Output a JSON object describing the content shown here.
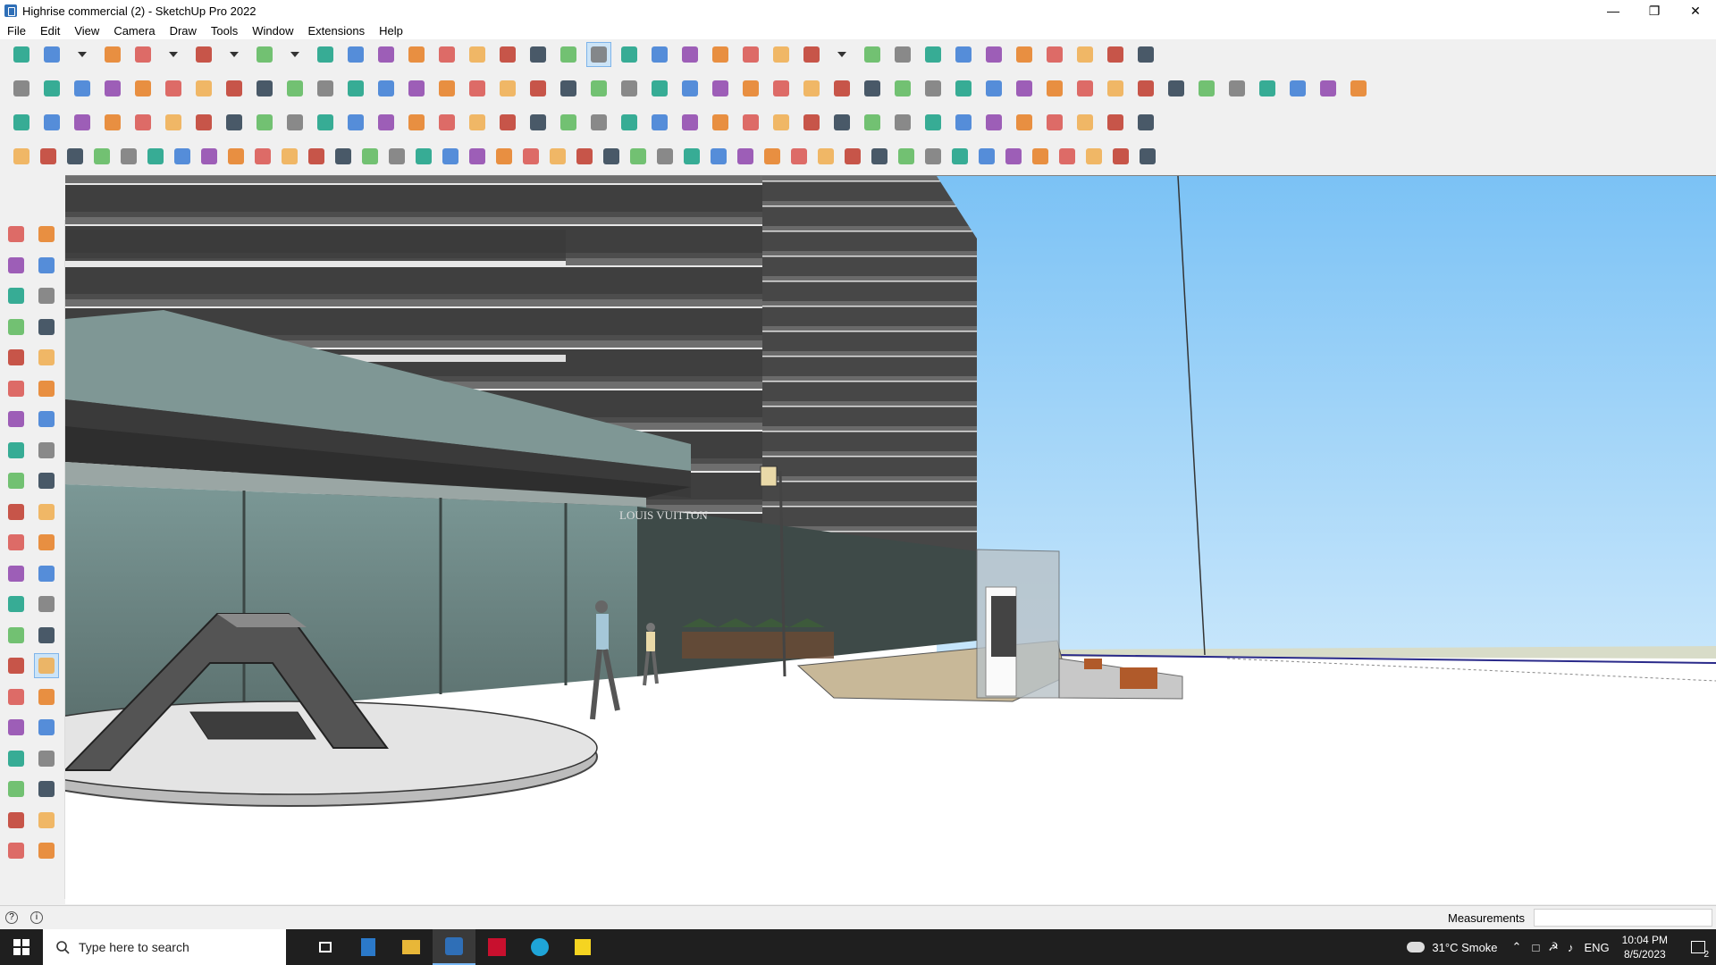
{
  "window": {
    "title": "Highrise commercial (2) - SketchUp Pro 2022",
    "controls": [
      "minimize",
      "restore",
      "close"
    ]
  },
  "menu": [
    "File",
    "Edit",
    "View",
    "Camera",
    "Draw",
    "Tools",
    "Window",
    "Extensions",
    "Help"
  ],
  "toolbar_rows": [
    {
      "icon_names": [
        "search-icon",
        "select-icon",
        "dropdown-icon",
        "eraser-icon",
        "pencil-icon",
        "dropdown-icon",
        "arc-icon",
        "dropdown-icon",
        "rectangle-icon",
        "dropdown-icon",
        "pushpull-icon",
        "followme-icon",
        "move-icon",
        "rotate-icon",
        "scale-icon",
        "tape-icon",
        "text-icon",
        "paint-icon",
        "orbit-icon",
        "pan-icon",
        "zoom-icon",
        "zoom-extents-icon",
        "section-icon",
        "section-display-icon",
        "section-fill-icon",
        "section-cut-icon",
        "component-icon",
        "dropdown-icon",
        "style-icon",
        "model-icon",
        "axis-icon",
        "arrow-up-down-icon",
        "arrow-down-up-icon",
        "scale-tool-icon",
        "xray-icon",
        "undo-icon",
        "redo-icon",
        "extension-icon"
      ]
    },
    {
      "icon_names": [
        "box-icon",
        "box-icon",
        "box-icon",
        "solid-icon",
        "solid-icon",
        "solid-icon",
        "solid-icon",
        "solid-icon",
        "solid-icon",
        "solid-icon",
        "solid-icon",
        "loop-icon",
        "line-icon",
        "line-icon",
        "line-icon",
        "shape-icon",
        "shape-icon",
        "house-icon",
        "house-icon",
        "house-icon",
        "house-icon",
        "house-icon",
        "house-icon",
        "curve-icon",
        "leaf-icon",
        "ruler-icon",
        "shape-icon",
        "shape-icon",
        "shape-icon",
        "shape-icon",
        "shape-icon",
        "shape-icon",
        "shape-icon",
        "shape-icon",
        "shape-icon",
        "shape-icon",
        "shape-icon",
        "shape-icon",
        "terrain-icon",
        "terrain-icon",
        "terrain-icon",
        "terrain-icon",
        "terrain-icon",
        "terrain-icon",
        "terrain-icon"
      ]
    },
    {
      "icon_names": [
        "plane-icon",
        "plane-icon",
        "plane-icon",
        "plane-icon",
        "plane-icon",
        "plane-icon",
        "loop-icon",
        "square-icon",
        "grid-icon",
        "shape-icon",
        "shape-icon",
        "shape-icon",
        "shape-icon",
        "shape-icon",
        "plus-icon",
        "plus-icon",
        "cross-icon",
        "cone-icon",
        "triangle-icon",
        "ring-icon",
        "ring-icon",
        "ring-icon",
        "star-icon",
        "cube-icon",
        "magnet-icon",
        "tool-icon",
        "tool-icon",
        "tool-icon",
        "tool-icon",
        "tool-icon",
        "tool-icon",
        "grid-icon",
        "grid-icon",
        "grid-icon",
        "grid-icon",
        "cross-icon",
        "curve-icon",
        "grid-icon"
      ]
    },
    {
      "icon_names": [
        "shape-icon",
        "shape-icon",
        "shape-icon",
        "shape-icon",
        "shape-icon",
        "shape-icon",
        "shape-icon",
        "shape-icon",
        "shape-icon",
        "shape-icon",
        "shape-icon",
        "shape-icon",
        "shape-icon",
        "shape-icon",
        "shape-icon",
        "shape-icon",
        "shape-icon",
        "shape-icon",
        "shape-icon",
        "shape-icon",
        "shape-icon",
        "shape-icon",
        "shape-icon",
        "shape-icon",
        "shape-icon",
        "shape-icon",
        "shape-icon",
        "shape-icon",
        "shape-icon",
        "shape-icon",
        "shape-icon",
        "shape-icon",
        "shape-icon",
        "shape-icon",
        "shape-icon",
        "shape-icon",
        "shape-icon",
        "shape-icon",
        "shape-icon",
        "shape-icon",
        "shape-icon",
        "shape-icon",
        "shape-icon"
      ]
    }
  ],
  "left_toolbar": {
    "icon_names": [
      "select-icon",
      "orbit-icon",
      "paint-icon",
      "eraser-icon",
      "component-icon",
      "tape-icon",
      "pencil-icon",
      "freehand-icon",
      "rectangle-icon",
      "rotated-rectangle-icon",
      "circle-icon",
      "polygon-icon",
      "arc-icon",
      "arc2-icon",
      "pie-icon",
      "arc3-icon",
      "move-icon",
      "pushpull-icon",
      "rotate-icon",
      "followme-icon",
      "scale-icon",
      "offset-icon",
      "tape-measure-icon",
      "dimension-icon",
      "protractor-icon",
      "text-icon",
      "axes-icon",
      "3d-text-icon",
      "orbit2-icon",
      "pan-icon",
      "zoom-icon",
      "zoom-window-icon",
      "zoom-extents-icon",
      "previous-view-icon",
      "position-camera-icon",
      "look-around-icon",
      "walk-icon",
      "section-plane-icon",
      "section-display-icon",
      "section-fill-icon",
      "section-cut-icon",
      "display-icon"
    ],
    "active_index": 29
  },
  "status": {
    "measurements_label": "Measurements",
    "measurements_value": ""
  },
  "taskbar": {
    "search_placeholder": "Type here to search",
    "weather": "31°C  Smoke",
    "language": "ENG",
    "time": "10:04 PM",
    "date": "8/5/2023",
    "notification_count": "2"
  },
  "scene": {
    "shop_sign": "LOUIS VUITTON"
  },
  "colors": {
    "sky_top": "#7bc2f5",
    "sky_bottom": "#bfe2fb",
    "building_dark": "#4a4a4a",
    "glass": "#6f8a88",
    "ground": "#ffffff"
  }
}
